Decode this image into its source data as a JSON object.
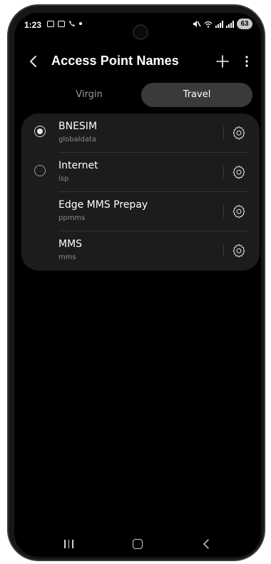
{
  "status": {
    "time": "1:23",
    "battery": "63"
  },
  "header": {
    "title": "Access Point Names"
  },
  "tabs": [
    {
      "label": "Virgin",
      "selected": false
    },
    {
      "label": "Travel",
      "selected": true
    }
  ],
  "apns": [
    {
      "name": "BNESIM",
      "sub": "globaldata",
      "radio": true,
      "selected": true
    },
    {
      "name": "Internet",
      "sub": "isp",
      "radio": true,
      "selected": false
    },
    {
      "name": "Edge MMS Prepay",
      "sub": "ppmms",
      "radio": false,
      "selected": false
    },
    {
      "name": "MMS",
      "sub": "mms",
      "radio": false,
      "selected": false
    }
  ],
  "icons": {
    "back": "chevron-left-icon",
    "add": "plus-icon",
    "more": "more-vert-icon",
    "settings": "gear-icon"
  },
  "colors": {
    "background": "#000000",
    "card": "#1c1c1c",
    "tab_selected": "#3a3a3a"
  }
}
